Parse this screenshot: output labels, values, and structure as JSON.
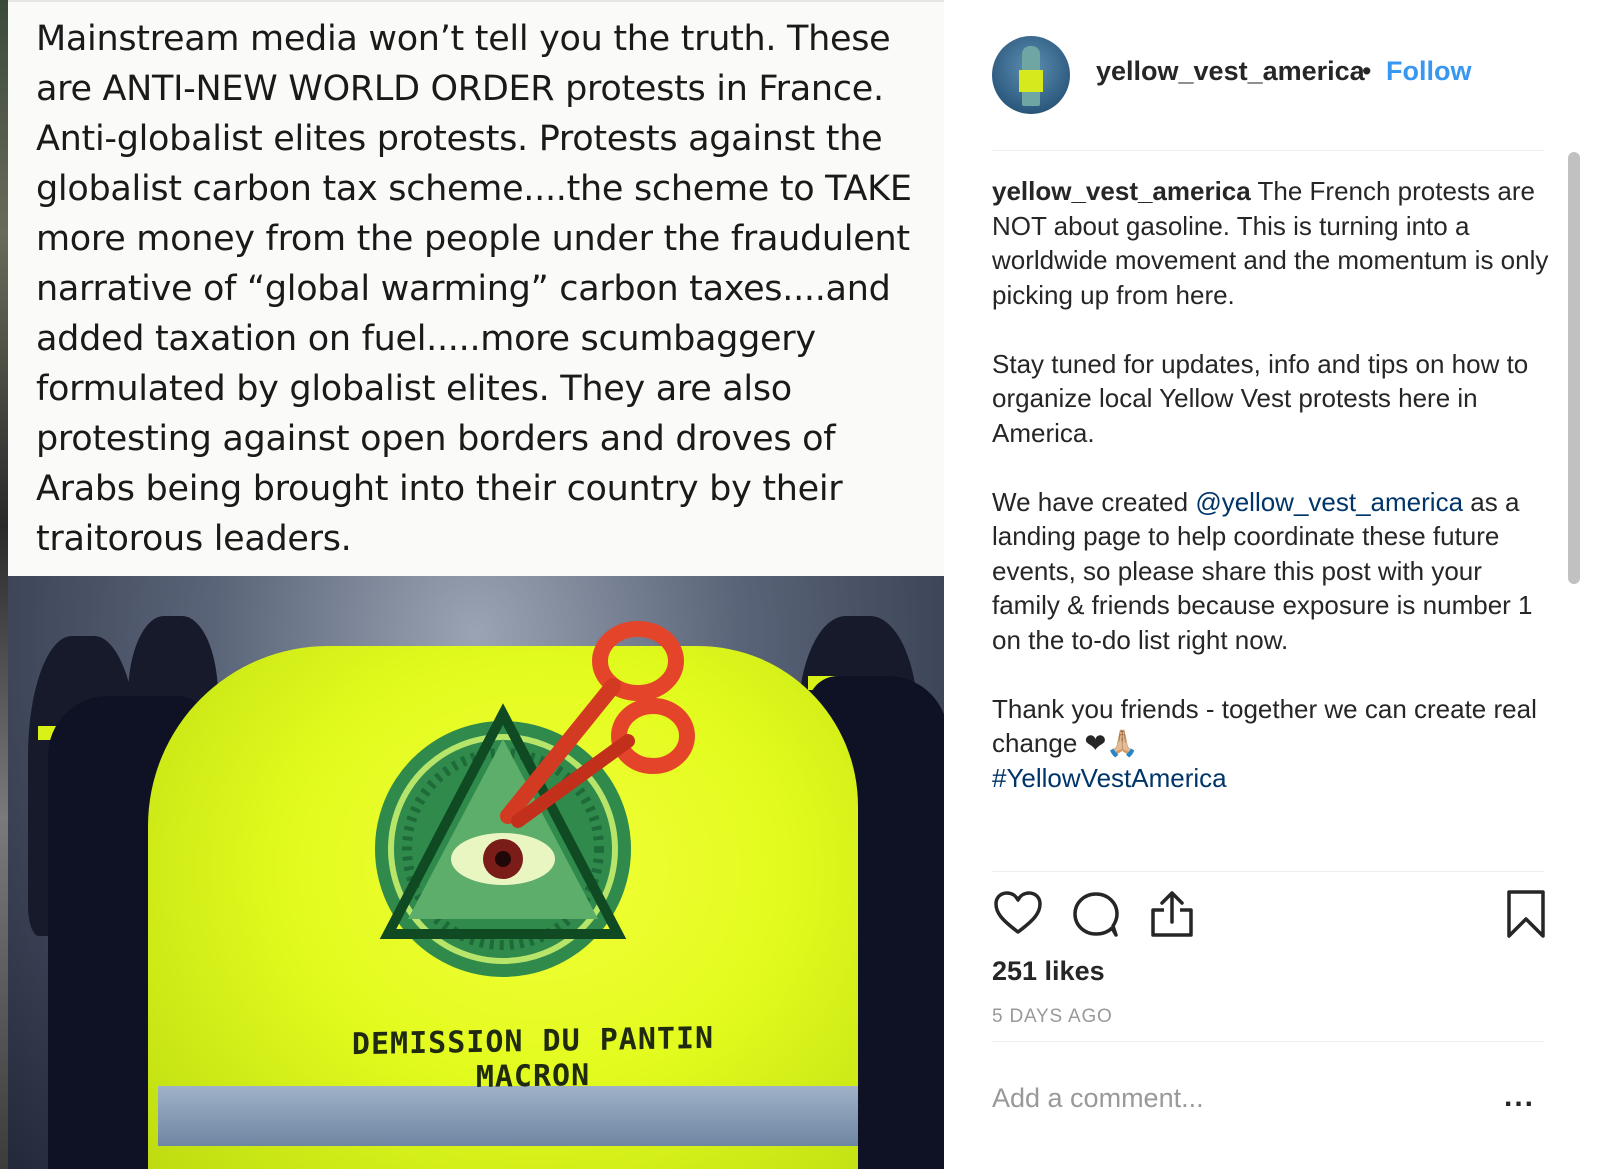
{
  "post": {
    "image_text": "Mainstream media won’t tell you the truth. These\nare ANTI-NEW WORLD ORDER protests in France.\nAnti-globalist elites protests. Protests against the\nglobalist carbon tax scheme....the scheme to TAKE\nmore money from the people under the fraudulent\nnarrative of “global warming” carbon taxes....and\nadded taxation on fuel.....more scumbaggery\nformulated by globalist elites. They are also\nprotesting against open borders and droves of\nArabs being brought into their country by their\ntraitorous leaders.",
    "vest_slogan": "DEMISSION DU PANTIN MACRON"
  },
  "header": {
    "username": "yellow_vest_america",
    "separator": "•",
    "follow_label": "Follow"
  },
  "caption": {
    "username": "yellow_vest_america",
    "p1": "The French protests are NOT about gasoline. This is turning into a worldwide movement and the momentum is only picking up from here.",
    "p2": "Stay tuned for updates, info and tips on how to organize local Yellow Vest protests here in America.",
    "p3_before": "We have created ",
    "p3_mention": "@yellow_vest_america",
    "p3_after": " as a landing page to help coordinate these future events, so please share this post with your family & friends because exposure is number 1 on the to-do list right now.",
    "p4": "Thank you friends - together we can create real change ❤🙏🏼",
    "hashtag": "#YellowVestAmerica"
  },
  "stats": {
    "likes": "251 likes",
    "timestamp": "5 DAYS AGO"
  },
  "comment": {
    "placeholder": "Add a comment...",
    "more_label": "..."
  },
  "icons": [
    "heart-icon",
    "comment-bubble-icon",
    "share-icon",
    "bookmark-icon"
  ],
  "colors": {
    "follow": "#3897f0",
    "link": "#003569",
    "muted": "#999999",
    "text": "#262626",
    "vest": "#e2fb1e"
  }
}
